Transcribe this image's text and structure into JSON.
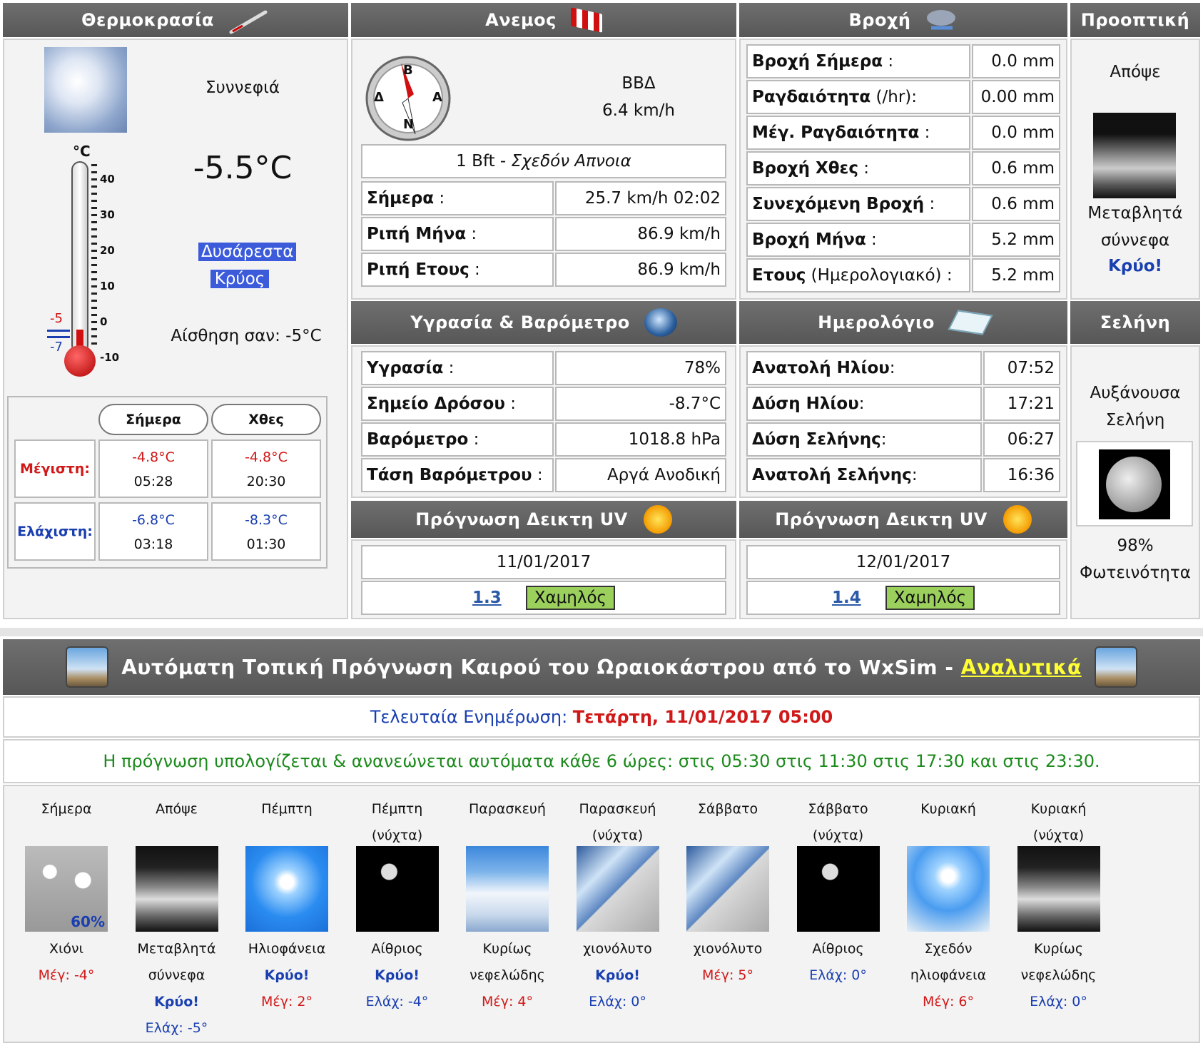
{
  "temp": {
    "header": "Θερμοκρασία",
    "condition": "Συννεφιά",
    "current": "-5.5°C",
    "comfort_line1": "Δυσάρεστα",
    "comfort_line2": "Κρύος",
    "feels_like": "Αίσθηση σαν: -5°C",
    "therm_unit": "°C",
    "therm_scale": [
      "40",
      "30",
      "20",
      "10",
      "0",
      "-10"
    ],
    "therm_max_mark": "-5",
    "therm_min_mark": "-7",
    "hdr_today": "Σήμερα",
    "hdr_yesterday": "Χθες",
    "max_label": "Μέγιστη:",
    "min_label": "Ελάχιστη:",
    "today_max": "-4.8°C",
    "today_max_time": "05:28",
    "yest_max": "-4.8°C",
    "yest_max_time": "20:30",
    "today_min": "-6.8°C",
    "today_min_time": "03:18",
    "yest_min": "-8.3°C",
    "yest_min_time": "01:30"
  },
  "wind": {
    "header": "Ανεμος",
    "compass": {
      "n": "B",
      "w": "Δ",
      "e": "A",
      "s": "N"
    },
    "direction": "ΒΒΔ",
    "speed": "6.4 km/h",
    "beaufort": "1 Bft - ",
    "beaufort_desc": "Σχεδόν Απνοια",
    "rows": [
      {
        "label": "Σήμερα",
        "sep": " :",
        "value": "25.7 km/h 02:02"
      },
      {
        "label": "Ριπή Μήνα",
        "sep": " :",
        "value": "86.9 km/h"
      },
      {
        "label": "Ριπή Ετους",
        "sep": " :",
        "value": "86.9 km/h"
      }
    ]
  },
  "rain": {
    "header": "Βροχή",
    "rows": [
      {
        "label": "Βροχή Σήμερα",
        "sep": " :",
        "value": "0.0 mm"
      },
      {
        "label": "Ραγδαιότητα",
        "sep": " (/hr):",
        "value": "0.00 mm"
      },
      {
        "label": "Μέγ. Ραγδαιότητα",
        "sep": " :",
        "value": "0.0 mm"
      },
      {
        "label": "Βροχή Χθες",
        "sep": " :",
        "value": "0.6 mm"
      },
      {
        "label": "Συνεχόμενη Βροχή",
        "sep": " :",
        "value": "0.6 mm"
      },
      {
        "label": "Βροχή Μήνα",
        "sep": " :",
        "value": "5.2 mm"
      },
      {
        "label": "Ετους",
        "sep": " (Ημερολογιακό) :",
        "value": "5.2 mm"
      }
    ]
  },
  "outlook": {
    "header": "Προοπτική",
    "period": "Απόψε",
    "desc1": "Μεταβλητά",
    "desc2": "σύννεφα",
    "note": "Κρύο!"
  },
  "humidity": {
    "header": "Υγρασία & Βαρόμετρο",
    "rows": [
      {
        "label": "Υγρασία",
        "sep": " :",
        "value": "78%"
      },
      {
        "label": "Σημείο Δρόσου",
        "sep": " :",
        "value": "-8.7°C"
      },
      {
        "label": "Βαρόμετρο",
        "sep": " :",
        "value": "1018.8 hPa"
      },
      {
        "label": "Τάση Βαρόμετρου",
        "sep": " :",
        "value": "Αργά Ανοδική"
      }
    ]
  },
  "almanac": {
    "header": "Ημερολόγιο",
    "rows": [
      {
        "label": "Ανατολή Ηλίου",
        "sep": ":",
        "value": "07:52"
      },
      {
        "label": "Δύση Ηλίου",
        "sep": ":",
        "value": "17:21"
      },
      {
        "label": "Δύση Σελήνης",
        "sep": ":",
        "value": "06:27"
      },
      {
        "label": "Ανατολή Σελήνης",
        "sep": ":",
        "value": "16:36"
      }
    ]
  },
  "moon": {
    "header": "Σελήνη",
    "phase1": "Αυξάνουσα",
    "phase2": "Σελήνη",
    "illum": "98%",
    "illum_label": "Φωτεινότητα"
  },
  "uv1": {
    "header": "Πρόγνωση Δεικτη UV",
    "date": "11/01/2017",
    "index": "1.3",
    "level": "Χαμηλός"
  },
  "uv2": {
    "header": "Πρόγνωση Δεικτη UV",
    "date": "12/01/2017",
    "index": "1.4",
    "level": "Χαμηλός"
  },
  "forecast": {
    "title": "Αυτόματη Τοπική Πρόγνωση Καιρού του Ωραιοκάστρου από το WxSim - ",
    "link": "Αναλυτικά",
    "updated_label": "Τελευταία Ενημέρωση: ",
    "updated_value": "Τετάρτη, 11/01/2017 05:00",
    "note": "Η πρόγνωση υπολογίζεται & ανανεώνεται αυτόματα κάθε 6 ώρες: στις 05:30 στις 11:30 στις 17:30 και στις 23:30.",
    "snow_pct": "60%",
    "days": [
      {
        "d1": "Σήμερα",
        "d2": "",
        "icon": "snow",
        "c1": "Χιόνι",
        "c2": "",
        "t1": "Μέγ: -4°",
        "t1c": "red",
        "t2": "",
        "t2c": "",
        "t3": "",
        "t3c": ""
      },
      {
        "d1": "Απόψε",
        "d2": "",
        "icon": "night-cloud",
        "c1": "Μεταβλητά",
        "c2": "σύννεφα",
        "t1": "",
        "t1c": "",
        "t2": "Κρύο!",
        "t2c": "blueb",
        "t3": "Ελάχ: -5°",
        "t3c": "blue"
      },
      {
        "d1": "Πέμπτη",
        "d2": "",
        "icon": "sun",
        "c1": "Ηλιοφάνεια",
        "c2": "",
        "t1": "Κρύο!",
        "t1c": "blueb",
        "t2": "Μέγ: 2°",
        "t2c": "red",
        "t3": "",
        "t3c": ""
      },
      {
        "d1": "Πέμπτη",
        "d2": "(νύχτα)",
        "icon": "night-clear",
        "c1": "Αίθριος",
        "c2": "",
        "t1": "Κρύο!",
        "t1c": "blueb",
        "t2": "Ελάχ: -4°",
        "t2c": "blue",
        "t3": "",
        "t3c": ""
      },
      {
        "d1": "Παρασκευή",
        "d2": "",
        "icon": "cloudy",
        "c1": "Κυρίως",
        "c2": "νεφελώδης",
        "t1": "",
        "t1c": "",
        "t2": "Μέγ: 4°",
        "t2c": "red",
        "t3": "",
        "t3c": ""
      },
      {
        "d1": "Παρασκευή",
        "d2": "(νύχτα)",
        "icon": "sleet",
        "c1": "χιονόλυτο",
        "c2": "",
        "t1": "Κρύο!",
        "t1c": "blueb",
        "t2": "Ελάχ: 0°",
        "t2c": "blue",
        "t3": "",
        "t3c": ""
      },
      {
        "d1": "Σάββατο",
        "d2": "",
        "icon": "sleet",
        "c1": "χιονόλυτο",
        "c2": "",
        "t1": "Μέγ: 5°",
        "t1c": "red",
        "t2": "",
        "t2c": "",
        "t3": "",
        "t3c": ""
      },
      {
        "d1": "Σάββατο",
        "d2": "(νύχτα)",
        "icon": "night-clear",
        "c1": "Αίθριος",
        "c2": "",
        "t1": "Ελάχ: 0°",
        "t1c": "blue",
        "t2": "",
        "t2c": "",
        "t3": "",
        "t3c": ""
      },
      {
        "d1": "Κυριακή",
        "d2": "",
        "icon": "sun-soft",
        "c1": "Σχεδόν",
        "c2": "ηλιοφάνεια",
        "t1": "",
        "t1c": "",
        "t2": "Μέγ: 6°",
        "t2c": "red",
        "t3": "",
        "t3c": ""
      },
      {
        "d1": "Κυριακή",
        "d2": "(νύχτα)",
        "icon": "night-cloud",
        "c1": "Κυρίως",
        "c2": "νεφελώδης",
        "t1": "",
        "t1c": "",
        "t2": "Ελάχ: 0°",
        "t2c": "blue",
        "t3": "",
        "t3c": ""
      }
    ]
  }
}
